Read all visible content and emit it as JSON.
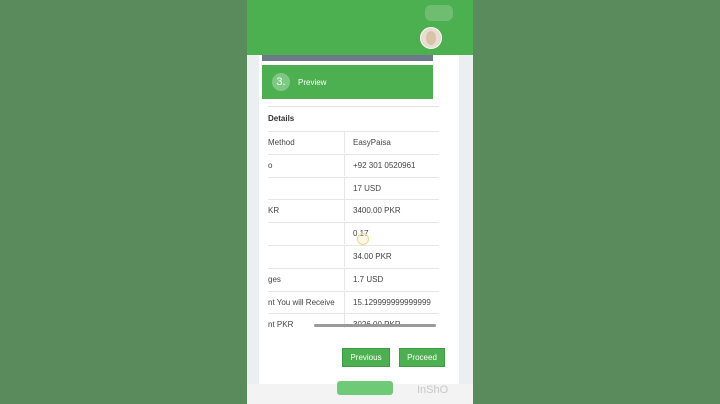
{
  "step": {
    "number": "3.",
    "title": "Preview"
  },
  "details": {
    "title": "Details",
    "rows": [
      {
        "label": "Method",
        "value": "EasyPaisa"
      },
      {
        "label": "o",
        "value": "+92 301 0520961"
      },
      {
        "label": "",
        "value": "17 USD"
      },
      {
        "label": "KR",
        "value": "3400.00 PKR"
      },
      {
        "label": "",
        "value": "0.17"
      },
      {
        "label": "",
        "value": "34.00 PKR"
      },
      {
        "label": "ges",
        "value": "1.7 USD"
      },
      {
        "label": "nt You will Receive",
        "value": "15.129999999999999"
      },
      {
        "label": "nt PKR",
        "value": "3026.00 PKR"
      }
    ]
  },
  "buttons": {
    "previous": "Previous",
    "proceed": "Proceed"
  },
  "watermark": "InShO",
  "colors": {
    "accent": "#4caf50",
    "background": "#5a8b5d"
  }
}
